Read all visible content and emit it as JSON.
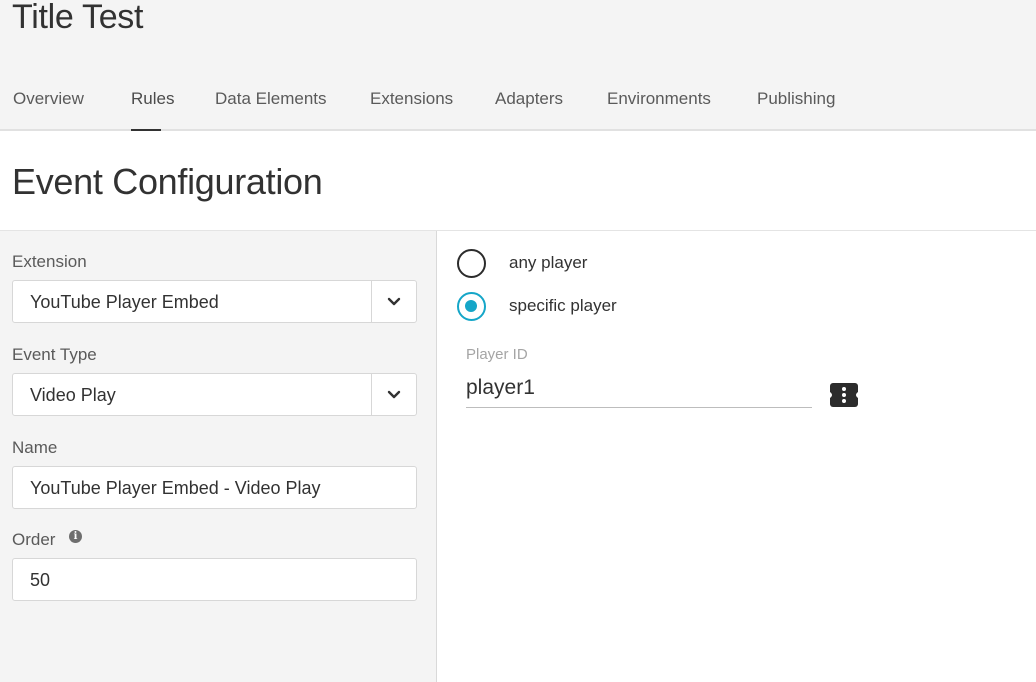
{
  "app": {
    "title": "Title Test"
  },
  "tabs": [
    {
      "label": "Overview"
    },
    {
      "label": "Rules"
    },
    {
      "label": "Data Elements"
    },
    {
      "label": "Extensions"
    },
    {
      "label": "Adapters"
    },
    {
      "label": "Environments"
    },
    {
      "label": "Publishing"
    }
  ],
  "active_tab": "Rules",
  "page": {
    "title": "Event Configuration"
  },
  "form": {
    "extension_label": "Extension",
    "extension_value": "YouTube Player Embed",
    "event_type_label": "Event Type",
    "event_type_value": "Video Play",
    "name_label": "Name",
    "name_value": "YouTube Player Embed - Video Play",
    "order_label": "Order",
    "order_value": "50"
  },
  "player_options": [
    {
      "label": "any player",
      "checked": false
    },
    {
      "label": "specific player",
      "checked": true
    }
  ],
  "player_id": {
    "label": "Player ID",
    "value": "player1"
  },
  "icons": {
    "dropdown": "chevron-down-icon",
    "info": "info-icon",
    "data_element": "data-element-icon"
  },
  "colors": {
    "accent": "#15a6c8",
    "header_bg": "#f4f4f4"
  }
}
